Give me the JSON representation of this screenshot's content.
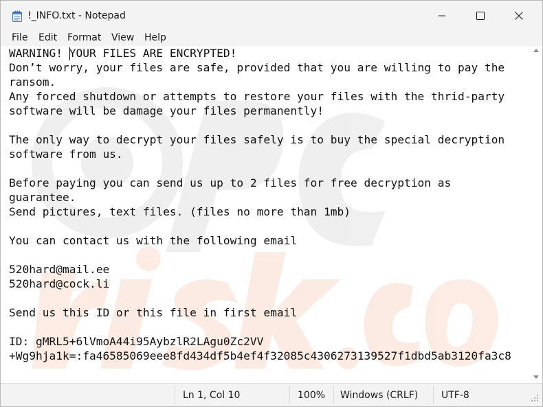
{
  "window": {
    "title": "!_INFO.txt - Notepad"
  },
  "menu": {
    "items": [
      "File",
      "Edit",
      "Format",
      "View",
      "Help"
    ]
  },
  "document": {
    "lines": [
      "WARNING! YOUR FILES ARE ENCRYPTED!",
      "Don’t worry, your files are safe, provided that you are willing to pay the",
      "ransom.",
      "Any forced shutdown or attempts to restore your files with the thrid-party",
      "software will be damage your files permanently!",
      "",
      "The only way to decrypt your files safely is to buy the special decryption",
      "software from us.",
      "",
      "Before paying you can send us up to 2 files for free decryption as",
      "guarantee.",
      "Send pictures, text files. (files no more than 1mb)",
      "",
      "You can contact us with the following email",
      "",
      "520hard@mail.ee",
      "520hard@cock.li",
      "",
      "Send us this ID or this file in first email",
      "",
      "ID: gMRL5+6lVmoA44i95AybzlR2LAgu0Zc2VV",
      "+Wg9hja1k=:fa46585069eee8fd434df5b4ef4f32085c4306273139527f1dbd5ab3120fa3c8"
    ]
  },
  "statusbar": {
    "position": "Ln 1, Col 10",
    "zoom": "100%",
    "line_ending": "Windows (CRLF)",
    "encoding": "UTF-8"
  },
  "icons": {
    "app": "notepad-icon",
    "minimize": "minimize-icon",
    "maximize": "maximize-icon",
    "close": "close-icon"
  },
  "watermark": {
    "text": "risk.com"
  },
  "colors": {
    "chrome": "#f3f3f3",
    "text": "#111111",
    "watermark_gray": "#c8c8c8",
    "watermark_orange": "#f0a070"
  }
}
